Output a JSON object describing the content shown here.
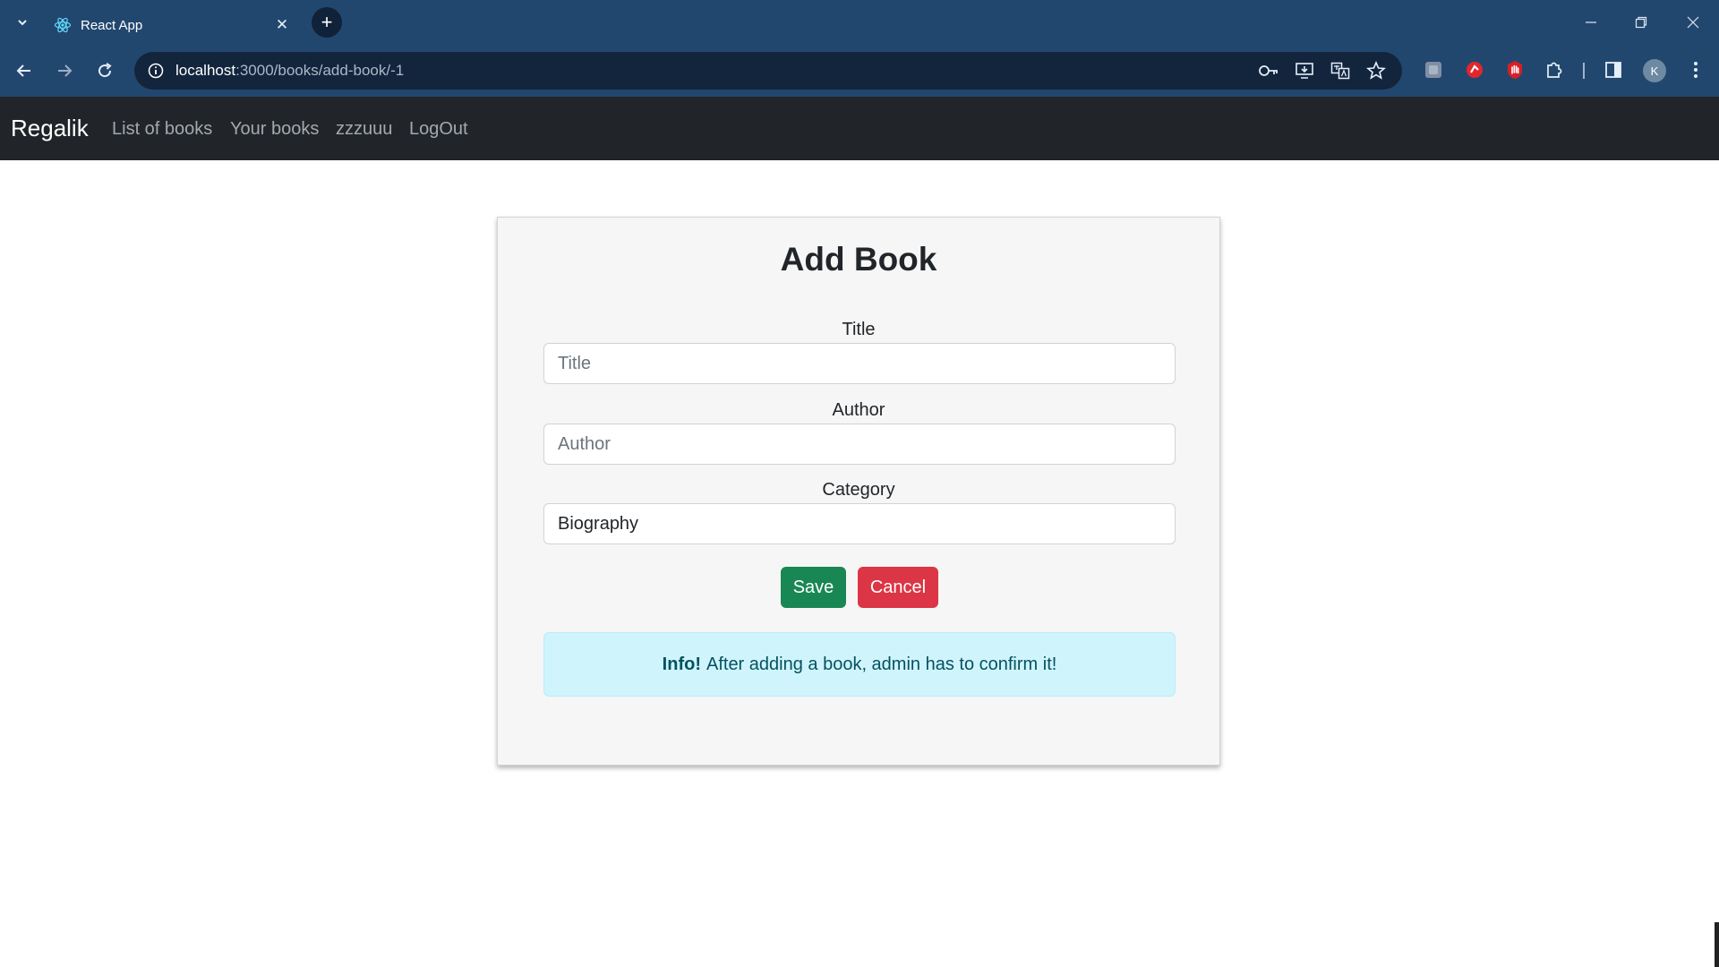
{
  "browser": {
    "tab_title": "React App",
    "url_host": "localhost",
    "url_rest": ":3000/books/add-book/-1",
    "profile_initial": "K",
    "accent": "#22476f"
  },
  "navbar": {
    "brand": "Regalik",
    "links": [
      "List of books",
      "Your books",
      "zzzuuu",
      "LogOut"
    ]
  },
  "form": {
    "heading": "Add Book",
    "title_label": "Title",
    "title_placeholder": "Title",
    "author_label": "Author",
    "author_placeholder": "Author",
    "category_label": "Category",
    "category_value": "Biography",
    "save_label": "Save",
    "cancel_label": "Cancel"
  },
  "alert": {
    "strong": "Info!",
    "text": "After adding a book, admin has to confirm it!"
  },
  "colors": {
    "save": "#198754",
    "cancel": "#dc3545",
    "info_bg": "#cff4fc"
  }
}
